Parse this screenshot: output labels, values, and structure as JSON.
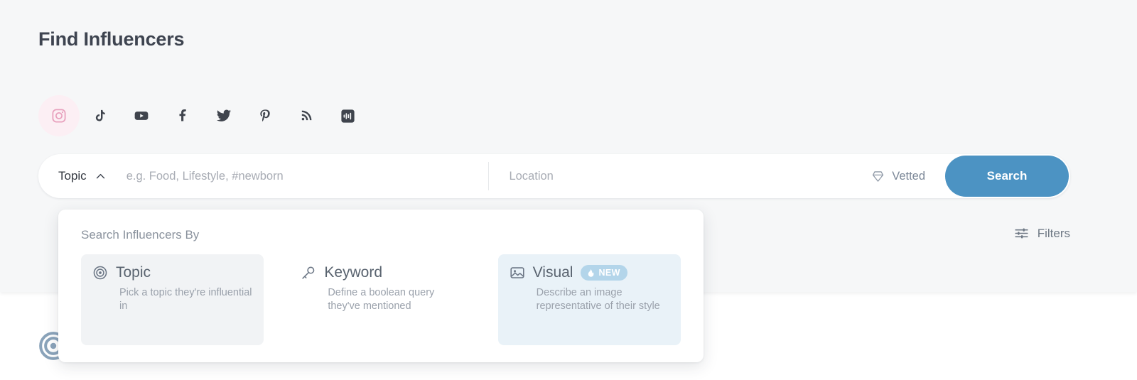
{
  "page": {
    "title": "Find Influencers"
  },
  "networks": [
    {
      "name": "instagram",
      "label": "Instagram",
      "selected": true
    },
    {
      "name": "tiktok",
      "label": "TikTok",
      "selected": false
    },
    {
      "name": "youtube",
      "label": "YouTube",
      "selected": false
    },
    {
      "name": "facebook",
      "label": "Facebook",
      "selected": false
    },
    {
      "name": "twitter",
      "label": "Twitter",
      "selected": false
    },
    {
      "name": "pinterest",
      "label": "Pinterest",
      "selected": false
    },
    {
      "name": "blog",
      "label": "Blog",
      "selected": false
    },
    {
      "name": "podcast",
      "label": "Podcast",
      "selected": false
    }
  ],
  "search": {
    "mode_label": "Topic",
    "mode_chevron": "chevron-up-icon",
    "topic_value": "",
    "topic_placeholder": "e.g. Food, Lifestyle, #newborn",
    "location_value": "",
    "location_placeholder": "Location",
    "vetted_label": "Vetted",
    "vetted_icon": "diamond-icon",
    "search_button_label": "Search"
  },
  "filters": {
    "label": "Filters",
    "icon": "sliders-icon"
  },
  "dropdown": {
    "title": "Search Influencers By",
    "options": [
      {
        "icon": "target-icon",
        "name": "Topic",
        "description": "Pick a topic they're influential in",
        "state": "selected",
        "badge": null
      },
      {
        "icon": "key-icon",
        "name": "Keyword",
        "description": "Define a boolean query they've mentioned",
        "state": "default",
        "badge": null
      },
      {
        "icon": "image-icon",
        "name": "Visual",
        "description": "Describe an image representative of their style",
        "state": "highlight",
        "badge": {
          "text": "NEW",
          "icon": "flame-icon"
        }
      }
    ]
  },
  "background": {
    "bullseye_icon": "target-icon"
  },
  "colors": {
    "page_bg": "#ffffff",
    "header_bg": "#f6f7f8",
    "accent_blue": "#4c93c3",
    "instagram_pink_bg": "#fceff4",
    "instagram_pink": "#e8a0bd",
    "card_selected_bg": "#f1f3f5",
    "card_highlight_bg": "#e9f2f8",
    "badge_bg": "#b3d5ea",
    "text_dark": "#3e4450",
    "text_muted": "#9aa1ab"
  }
}
